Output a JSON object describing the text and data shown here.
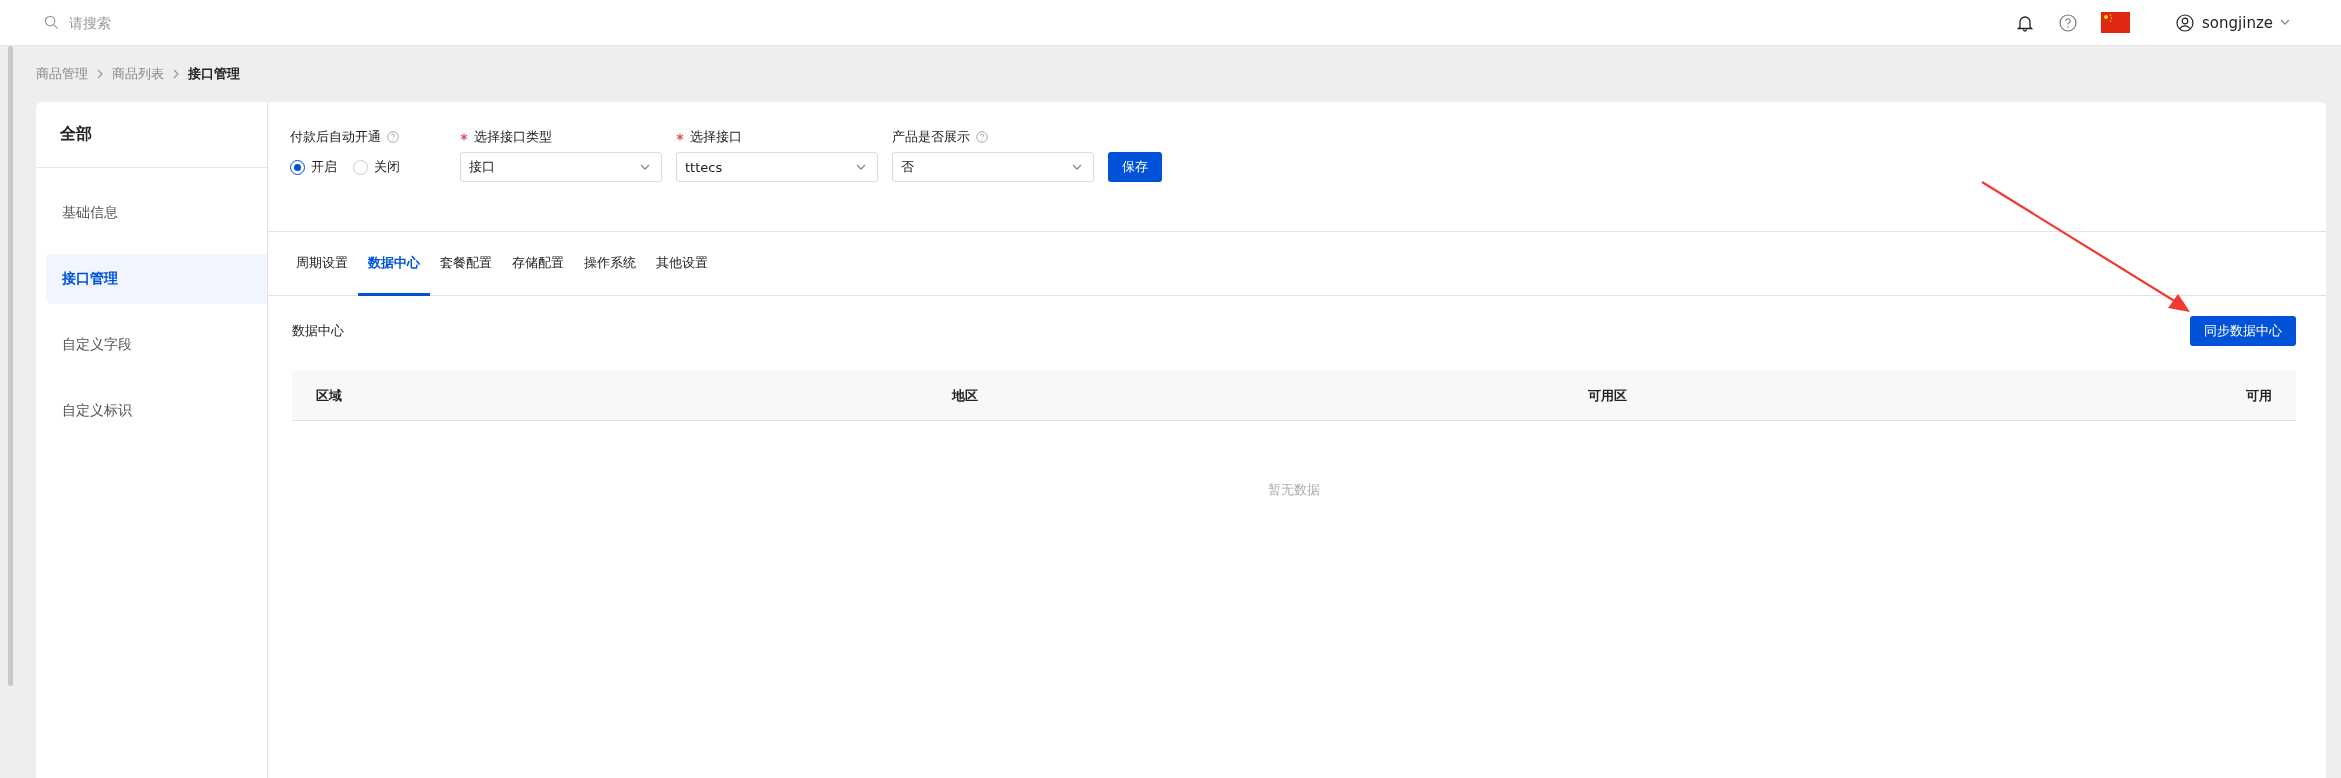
{
  "topbar": {
    "search": {
      "placeholder": "请搜索"
    },
    "user": {
      "name": "songjinze"
    }
  },
  "breadcrumb": [
    {
      "label": "商品管理",
      "current": false
    },
    {
      "label": "商品列表",
      "current": false
    },
    {
      "label": "接口管理",
      "current": true
    }
  ],
  "sidebar": {
    "title": "全部",
    "items": [
      {
        "label": "基础信息",
        "selected": false
      },
      {
        "label": "接口管理",
        "selected": true
      },
      {
        "label": "自定义字段",
        "selected": false
      },
      {
        "label": "自定义标识",
        "selected": false
      }
    ]
  },
  "form": {
    "fields": [
      {
        "kind": "radio",
        "label": "付款后自动开通",
        "required": false,
        "help": true,
        "options": [
          {
            "label": "开启",
            "selected": true
          },
          {
            "label": "关闭",
            "selected": false
          }
        ]
      },
      {
        "kind": "select",
        "label": "选择接口类型",
        "required": true,
        "help": false,
        "value": "接口"
      },
      {
        "kind": "select",
        "label": "选择接口",
        "required": true,
        "help": false,
        "value": "tttecs"
      },
      {
        "kind": "select",
        "label": "产品是否展示",
        "required": false,
        "help": true,
        "value": "否"
      }
    ],
    "save_button": "保存"
  },
  "tabs": [
    {
      "label": "周期设置",
      "selected": false
    },
    {
      "label": "数据中心",
      "selected": true
    },
    {
      "label": "套餐配置",
      "selected": false
    },
    {
      "label": "存储配置",
      "selected": false
    },
    {
      "label": "操作系统",
      "selected": false
    },
    {
      "label": "其他设置",
      "selected": false
    }
  ],
  "section": {
    "title": "数据中心",
    "sync_button": "同步数据中心"
  },
  "table": {
    "columns": [
      "区域",
      "地区",
      "可用区",
      "可用"
    ],
    "empty_text": "暂无数据"
  }
}
